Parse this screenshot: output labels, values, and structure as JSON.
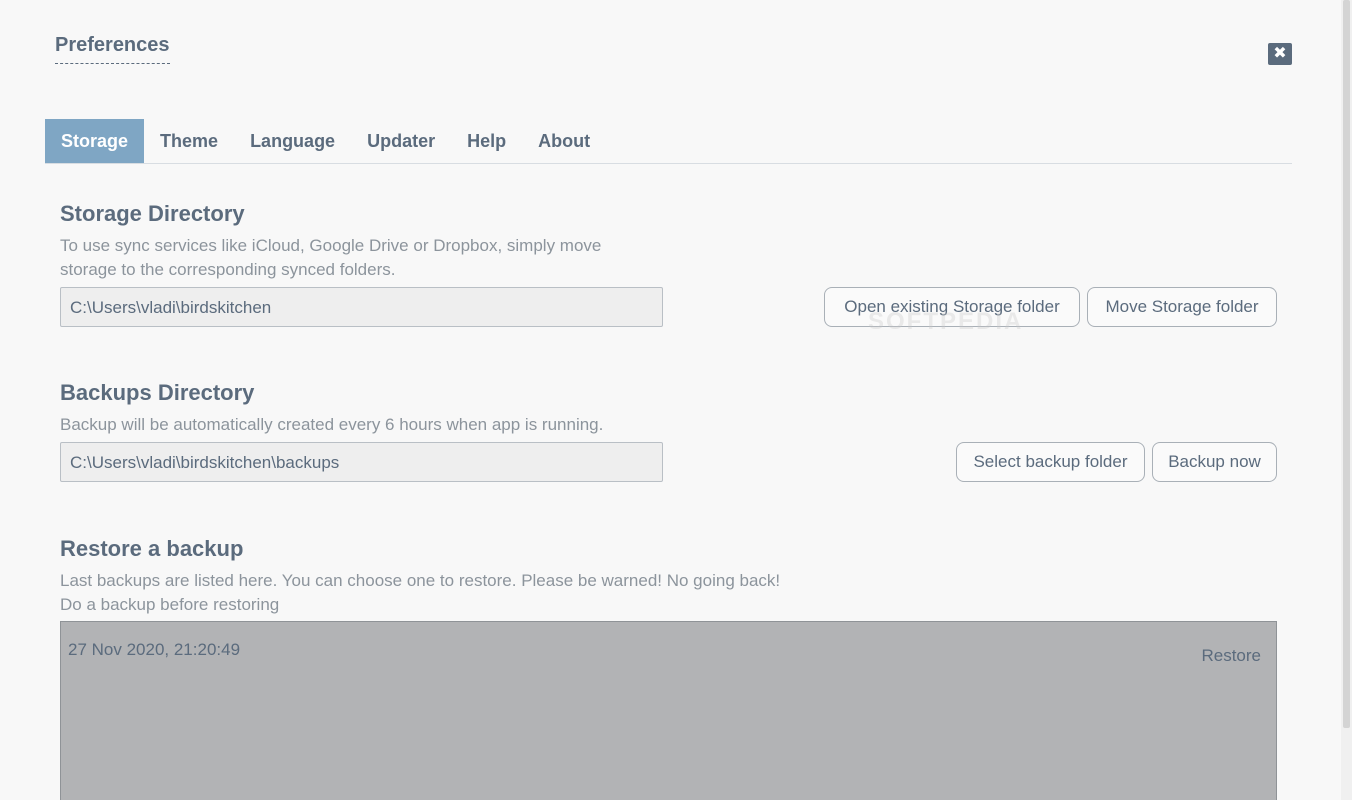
{
  "window": {
    "title": "Preferences",
    "close_icon": "close-icon"
  },
  "tabs": [
    {
      "label": "Storage",
      "active": true
    },
    {
      "label": "Theme",
      "active": false
    },
    {
      "label": "Language",
      "active": false
    },
    {
      "label": "Updater",
      "active": false
    },
    {
      "label": "Help",
      "active": false
    },
    {
      "label": "About",
      "active": false
    }
  ],
  "storage": {
    "title": "Storage Directory",
    "desc_line1": "To use sync services like iCloud, Google Drive or Dropbox, simply move",
    "desc_line2": "storage to the corresponding synced folders.",
    "path": "C:\\Users\\vladi\\birdskitchen",
    "open_button": "Open existing Storage folder",
    "move_button": "Move Storage folder"
  },
  "backups": {
    "title": "Backups Directory",
    "desc": "Backup will be automatically created every 6 hours when app is running.",
    "path": "C:\\Users\\vladi\\birdskitchen\\backups",
    "select_button": "Select backup folder",
    "backup_button": "Backup now"
  },
  "restore": {
    "title": "Restore a backup",
    "desc_line1": "Last backups are listed here. You can choose one to restore. Please be warned! No going back!",
    "desc_line2": "Do a backup before restoring",
    "items": [
      {
        "date": "27 Nov 2020, 21:20:49",
        "action": "Restore"
      }
    ]
  },
  "watermark": "SOFTPEDIA",
  "colors": {
    "accent": "#7fa6c4",
    "text": "#5b6b7d",
    "muted": "#8c949c",
    "list_bg": "#b2b3b5"
  }
}
